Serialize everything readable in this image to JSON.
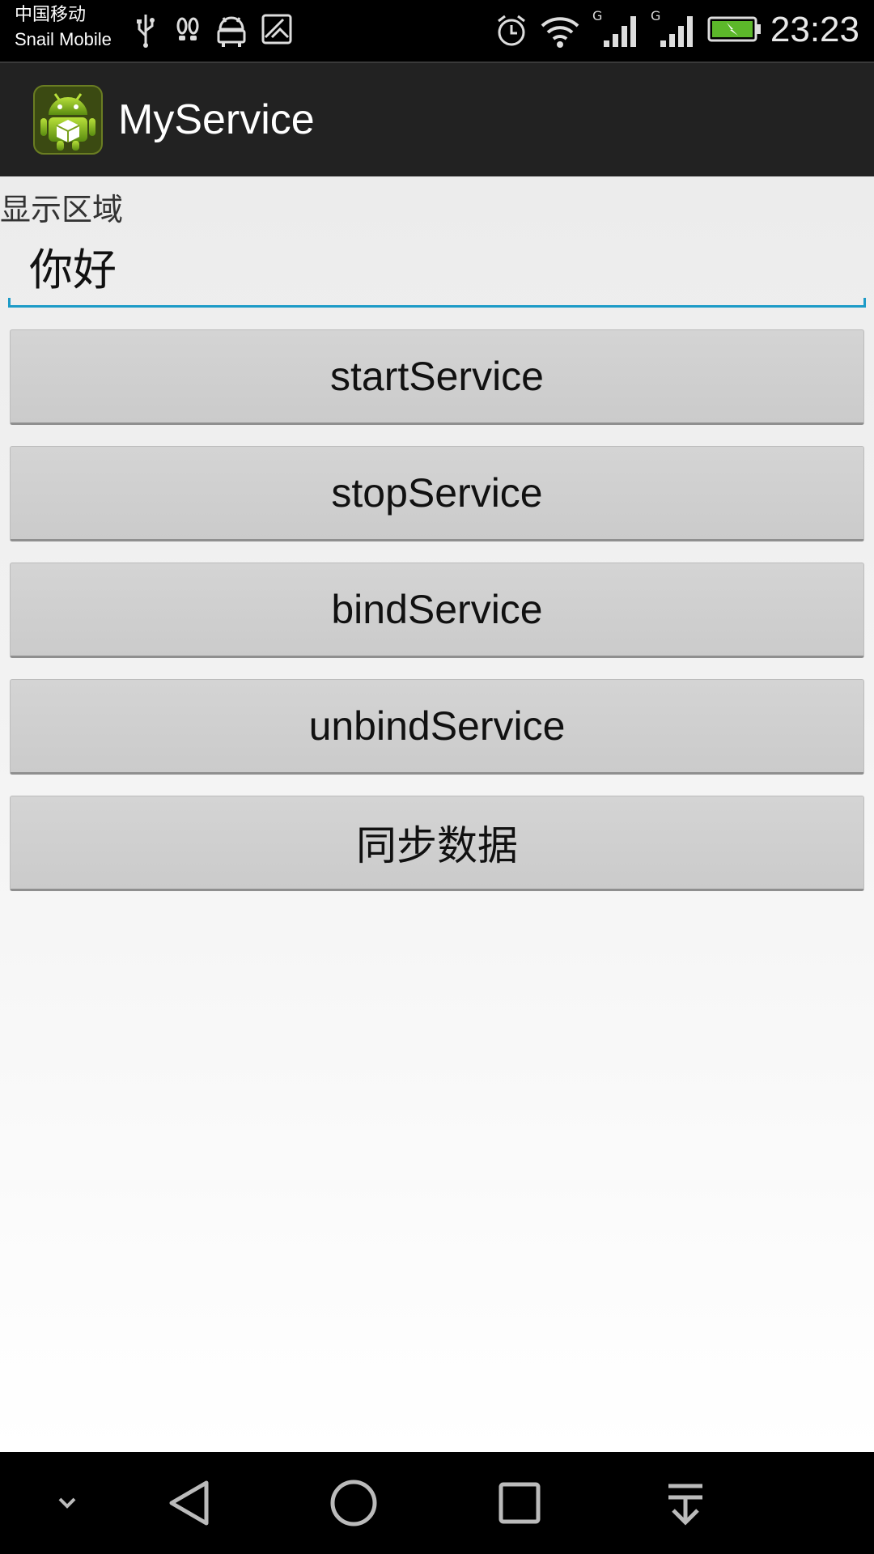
{
  "status_bar": {
    "carrier_line1": "中国移动",
    "carrier_line2": "Snail Mobile",
    "time": "23:23",
    "icons": [
      "usb-icon",
      "footprints-icon",
      "android-icon",
      "image-icon",
      "alarm-icon",
      "wifi-icon",
      "signal-icon",
      "signal-icon",
      "battery-charging-icon"
    ],
    "network_label_1": "G",
    "network_label_2": "G"
  },
  "action_bar": {
    "title": "MyService",
    "icon": "android-app-icon"
  },
  "main": {
    "display_label": "显示区域",
    "text_field_value": "你好",
    "buttons": [
      {
        "label": "startService"
      },
      {
        "label": "stopService"
      },
      {
        "label": "bindService"
      },
      {
        "label": "unbindService"
      },
      {
        "label": "同步数据"
      }
    ]
  },
  "nav_bar": {
    "icons": [
      "chevron-down-icon",
      "back-icon",
      "home-icon",
      "recents-icon",
      "notification-pulldown-icon"
    ]
  },
  "colors": {
    "accent": "#1d9bc7",
    "action_bar": "#222222",
    "button": "#cfcfcf"
  }
}
